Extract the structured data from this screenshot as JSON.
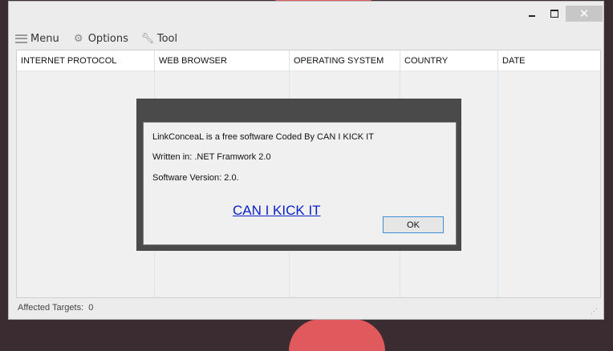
{
  "window": {
    "min_icon": "minimize-icon",
    "max_icon": "maximize-icon",
    "close_glyph": "✕"
  },
  "menubar": [
    {
      "label": "Menu",
      "icon": "hamburger-icon"
    },
    {
      "label": "Options",
      "icon": "gears-icon"
    },
    {
      "label": "Tool",
      "icon": "wrench-icon"
    }
  ],
  "table": {
    "columns": [
      "INTERNET PROTOCOL",
      "WEB BROWSER",
      "OPERATING SYSTEM",
      "COUNTRY",
      "DATE"
    ],
    "rows": []
  },
  "status": {
    "label": "Affected Targets:",
    "count": "0"
  },
  "dialog": {
    "line1": "LinkConceaL is a free software Coded By CAN I KICK IT",
    "line2": "Written in: .NET Framwork 2.0",
    "line3": "Software Version: 2.0.",
    "link": "CAN I KICK IT",
    "ok": "OK"
  },
  "colors": {
    "link": "#0b21c7",
    "accent": "#3c8ed8",
    "desktop_decoration": "#e0595c"
  }
}
